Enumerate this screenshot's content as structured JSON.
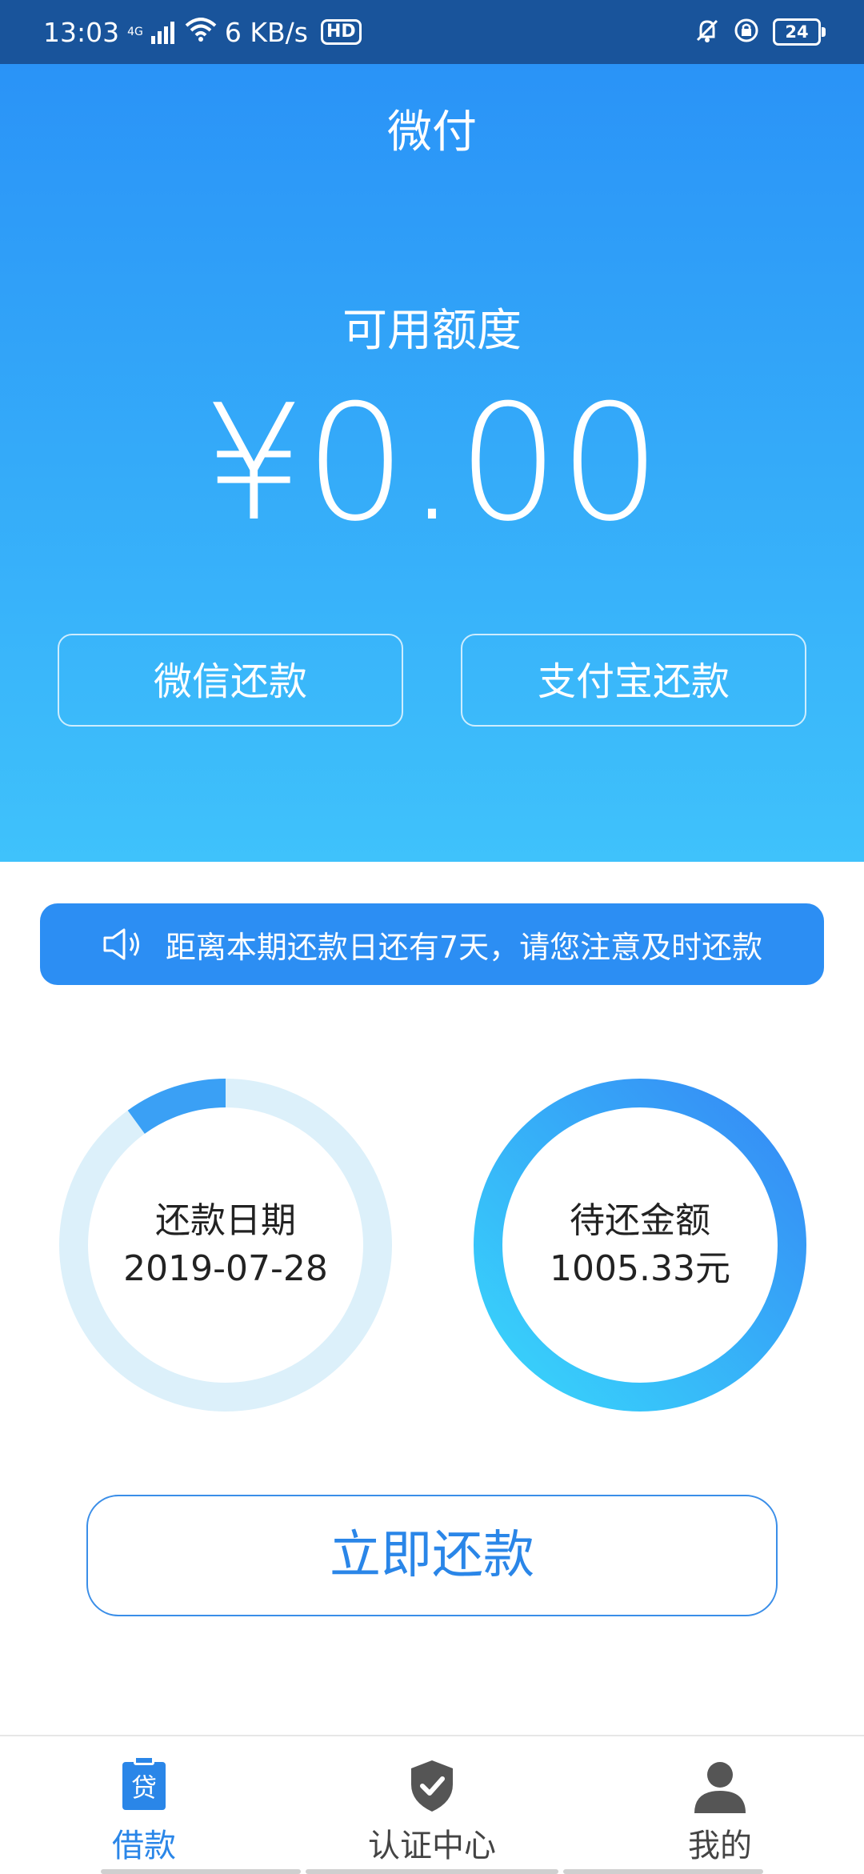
{
  "status_bar": {
    "time": "13:03",
    "network": "4G",
    "speed": "6 KB/s",
    "hd": "HD",
    "battery": "24"
  },
  "header": {
    "app_title": "微付",
    "credit_label": "可用额度",
    "credit_amount": "¥0.00",
    "wechat_repay": "微信还款",
    "alipay_repay": "支付宝还款"
  },
  "notice": {
    "text": "距离本期还款日还有7天，请您注意及时还款",
    "icon": "speaker-icon"
  },
  "repay_date": {
    "label": "还款日期",
    "value": "2019-07-28",
    "progress": 0.1
  },
  "due_amount": {
    "label": "待还金额",
    "value": "1005.33元",
    "progress": 1.0
  },
  "repay_now_label": "立即还款",
  "tabs": [
    {
      "label": "借款",
      "icon": "loan-icon",
      "icon_text": "贷",
      "active": true
    },
    {
      "label": "认证中心",
      "icon": "shield-check-icon",
      "active": false
    },
    {
      "label": "我的",
      "icon": "user-icon",
      "active": false
    }
  ],
  "colors": {
    "primary": "#2a86e8",
    "header_top": "#2a93f7",
    "header_bottom": "#3fc2fb",
    "status_bar": "#19549b",
    "ring_track": "#dcf0fa"
  }
}
